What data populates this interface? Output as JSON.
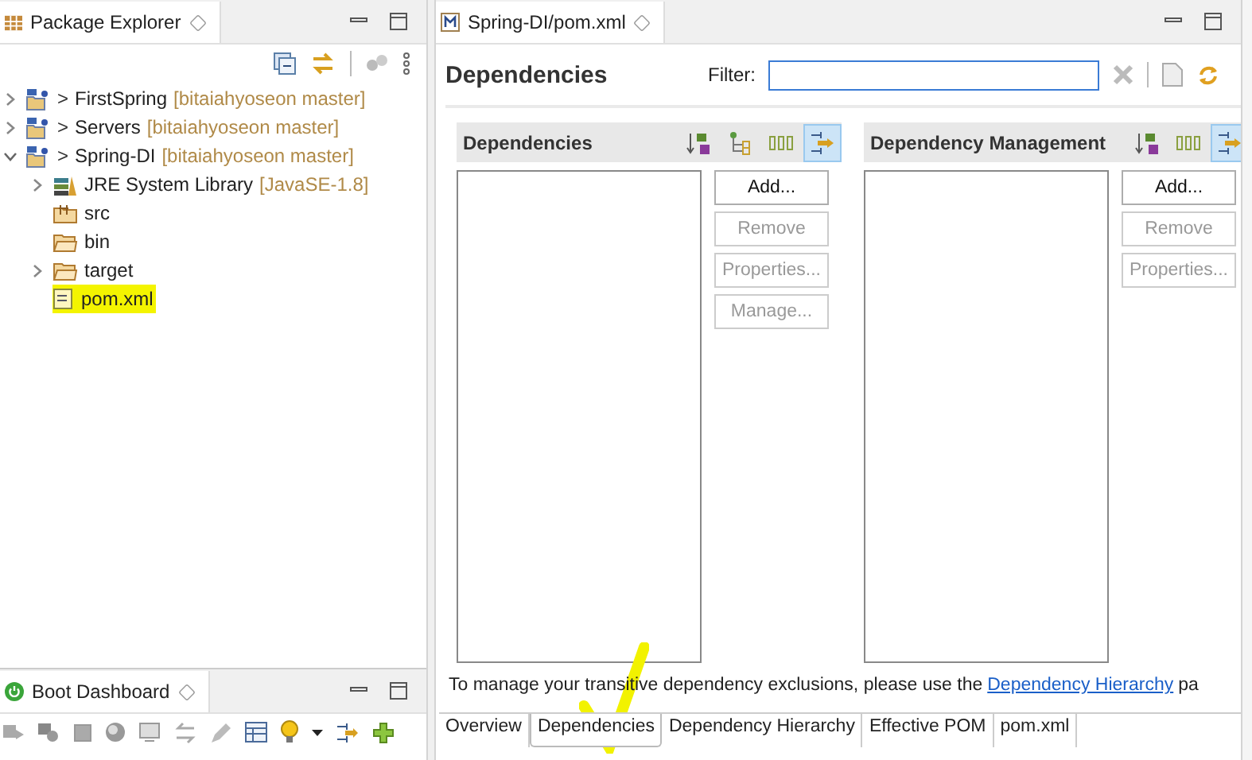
{
  "package_explorer": {
    "title": "Package Explorer",
    "tree": [
      {
        "label": "FirstSpring",
        "prefix": ">",
        "decoration": "[bitaiahyoseon master]",
        "kind": "project",
        "expanded": false,
        "highlighted": false
      },
      {
        "label": "Servers",
        "prefix": ">",
        "decoration": "[bitaiahyoseon master]",
        "kind": "project",
        "expanded": false,
        "highlighted": false
      },
      {
        "label": "Spring-DI",
        "prefix": ">",
        "decoration": "[bitaiahyoseon master]",
        "kind": "project",
        "expanded": true,
        "highlighted": false,
        "children": [
          {
            "label": "JRE System Library",
            "decoration": "[JavaSE-1.8]",
            "kind": "library",
            "expanded": false,
            "highlighted": false
          },
          {
            "label": "src",
            "kind": "source-folder",
            "highlighted": false
          },
          {
            "label": "bin",
            "kind": "folder",
            "highlighted": false
          },
          {
            "label": "target",
            "kind": "folder",
            "expanded": false,
            "highlighted": false
          },
          {
            "label": "pom.xml",
            "kind": "pom",
            "highlighted": true
          }
        ]
      }
    ]
  },
  "boot_dashboard": {
    "title": "Boot Dashboard"
  },
  "editor": {
    "tab": "Spring-DI/pom.xml",
    "form_title": "Dependencies",
    "filter": {
      "label": "Filter:"
    },
    "sections": [
      {
        "title": "Dependencies",
        "tools": [
          {
            "kind": "sort",
            "selected": false
          },
          {
            "kind": "tree",
            "selected": false
          },
          {
            "kind": "columns",
            "selected": false
          },
          {
            "kind": "link",
            "selected": true
          }
        ],
        "buttons": [
          {
            "label": "Add...",
            "disabled": false
          },
          {
            "label": "Remove",
            "disabled": true
          },
          {
            "label": "Properties...",
            "disabled": true
          },
          {
            "label": "Manage...",
            "disabled": true
          }
        ]
      },
      {
        "title": "Dependency Management",
        "tools": [
          {
            "kind": "sort",
            "selected": false
          },
          {
            "kind": "columns",
            "selected": false
          },
          {
            "kind": "link",
            "selected": true
          }
        ],
        "buttons": [
          {
            "label": "Add...",
            "disabled": false
          },
          {
            "label": "Remove",
            "disabled": true
          },
          {
            "label": "Properties...",
            "disabled": true
          }
        ]
      }
    ],
    "info": {
      "text": "To manage your transitive dependency exclusions, please use the",
      "link": "Dependency Hierarchy",
      "tail": "pa"
    },
    "bottom_tabs": [
      {
        "label": "Overview",
        "selected": false
      },
      {
        "label": "Dependencies",
        "selected": true
      },
      {
        "label": "Dependency Hierarchy",
        "selected": false
      },
      {
        "label": "Effective POM",
        "selected": false
      },
      {
        "label": "pom.xml",
        "selected": false
      }
    ]
  }
}
